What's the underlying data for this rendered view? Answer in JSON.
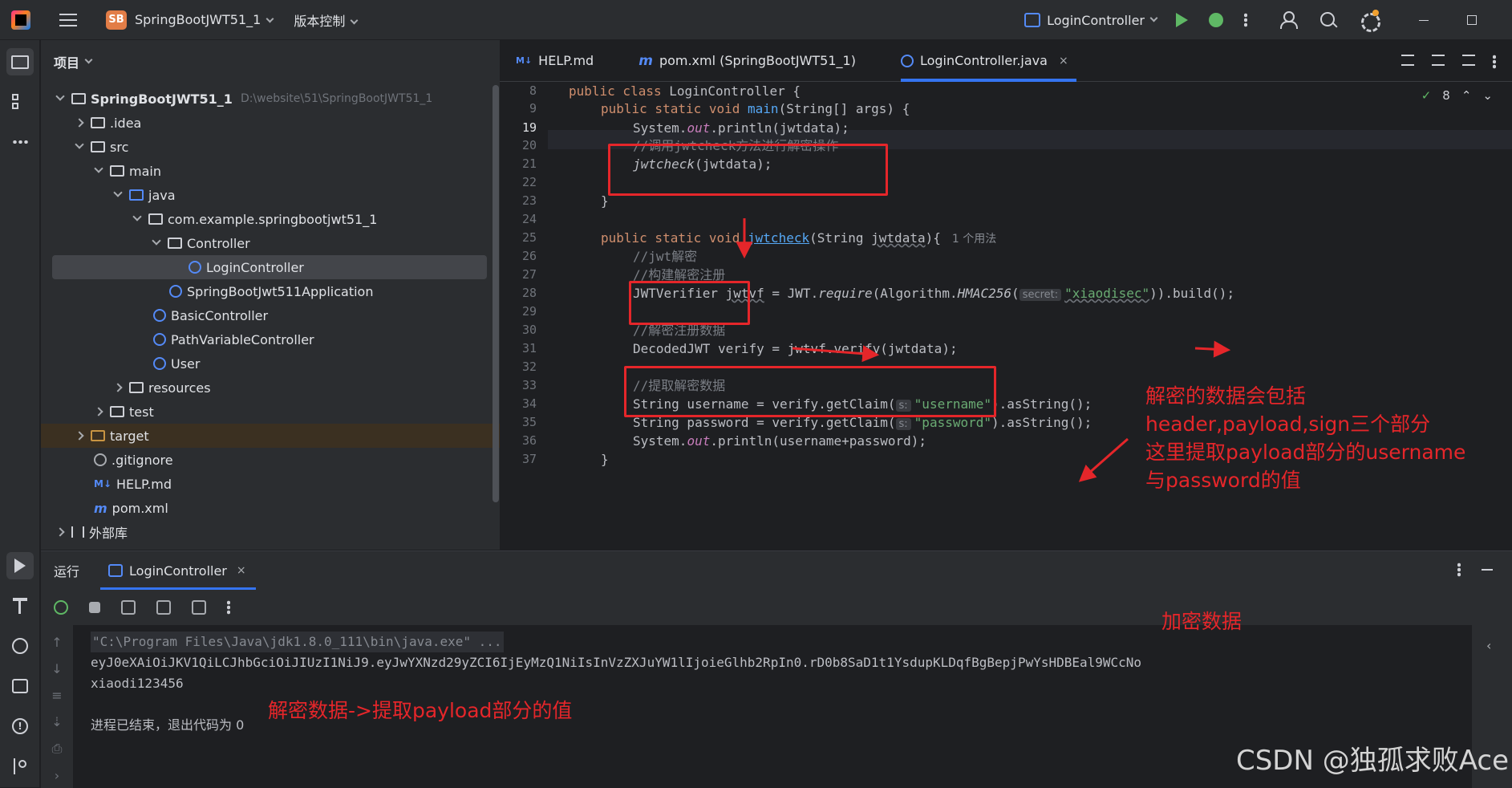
{
  "titlebar": {
    "project_badge": "SB",
    "project_name": "SpringBootJWT51_1",
    "vcs_menu": "版本控制",
    "run_config": "LoginController"
  },
  "sidebar": {
    "header": "项目",
    "items": [
      {
        "label": "SpringBootJWT51_1",
        "path": "D:\\website\\51\\SpringBootJWT51_1"
      },
      {
        "label": ".idea"
      },
      {
        "label": "src"
      },
      {
        "label": "main"
      },
      {
        "label": "java"
      },
      {
        "label": "com.example.springbootjwt51_1"
      },
      {
        "label": "Controller"
      },
      {
        "label": "LoginController"
      },
      {
        "label": "SpringBootJwt511Application"
      },
      {
        "label": "BasicController"
      },
      {
        "label": "PathVariableController"
      },
      {
        "label": "User"
      },
      {
        "label": "resources"
      },
      {
        "label": "test"
      },
      {
        "label": "target"
      },
      {
        "label": ".gitignore"
      },
      {
        "label": "HELP.md"
      },
      {
        "label": "pom.xml"
      },
      {
        "label": "外部库"
      }
    ]
  },
  "editor": {
    "tabs": [
      {
        "icon": "M↓",
        "label": "HELP.md"
      },
      {
        "icon": "m",
        "label": "pom.xml (SpringBootJWT51_1)"
      },
      {
        "icon": "C",
        "label": "LoginController.java",
        "close": "×"
      }
    ],
    "check_count": "8",
    "line_numbers": [
      "8",
      "9",
      "19",
      "20",
      "21",
      "22",
      "23",
      "24",
      "25",
      "26",
      "27",
      "28",
      "29",
      "30",
      "31",
      "32",
      "33",
      "34",
      "35",
      "36",
      "37"
    ],
    "code": {
      "l8_kw": "public class ",
      "l8_rest": "LoginController {",
      "l9_kw": "public static void ",
      "l9_fn": "main",
      "l9_rest": "(String[] args) {",
      "l19_a": "System.",
      "l19_b": "out",
      "l19_c": ".println(jwtdata);",
      "l20": "//调用jwtcheck方法进行解密操作",
      "l21_a": "jwtcheck",
      "l21_b": "(jwtdata);",
      "l23": "}",
      "l25_kw": "public static void ",
      "l25_fn": "jwtcheck",
      "l25_a": "(String ",
      "l25_b": "jwtdata",
      "l25_c": "){",
      "l25_usage": "1 个用法",
      "l26": "//jwt解密",
      "l27": "//构建解密注册",
      "l28_a": "JWTVerifier ",
      "l28_b": "jwtvf",
      "l28_c": " = JWT.",
      "l28_d": "require",
      "l28_e": "(Algorithm.",
      "l28_f": "HMAC256",
      "l28_g": "(",
      "l28_hint": "secret:",
      "l28_str": "\"xiaodisec\"",
      "l28_h": ")).build();",
      "l30": "//解密注册数据",
      "l31": "DecodedJWT verify = jwtvf.verify(jwtdata);",
      "l33": "//提取解密数据",
      "l34_a": "String username = verify.getClaim(",
      "l34_hint": "s:",
      "l34_str": "\"username\"",
      "l34_b": ").asString();",
      "l35_a": "String password = verify.getClaim(",
      "l35_hint": "s:",
      "l35_str": "\"password\"",
      "l35_b": ").asString();",
      "l36_a": "System.",
      "l36_b": "out",
      "l36_c": ".println(username+password);",
      "l37": "}"
    }
  },
  "annotations": {
    "right_note": [
      "解密的数据会包括",
      "header,payload,sign三个部分",
      "这里提取payload部分的username",
      "与password的值"
    ],
    "encrypted": "加密数据",
    "decrypted": "解密数据->提取payload部分的值"
  },
  "run_panel": {
    "title": "运行",
    "tab": "LoginController",
    "tab_close": "×",
    "console": {
      "cmd": "\"C:\\Program Files\\Java\\jdk1.8.0_111\\bin\\java.exe\" ...",
      "token": "eyJ0eXAiOiJKV1QiLCJhbGciOiJIUzI1NiJ9.eyJwYXNzd29yZCI6IjEyMzQ1NiIsInVzZXJuYW1lIjoieGlhb2RpIn0.rD0b8SaD1t1YsdupKLDqfBgBepjPwYsHDBEal9WCcNo",
      "output": "xiaodi123456",
      "exit": "进程已结束，退出代码为 0"
    }
  },
  "watermark": "CSDN @独孤求败Ace",
  "colors": {
    "accent": "#3574f0",
    "annotation_red": "#e5262a",
    "run_green": "#5fb865"
  }
}
